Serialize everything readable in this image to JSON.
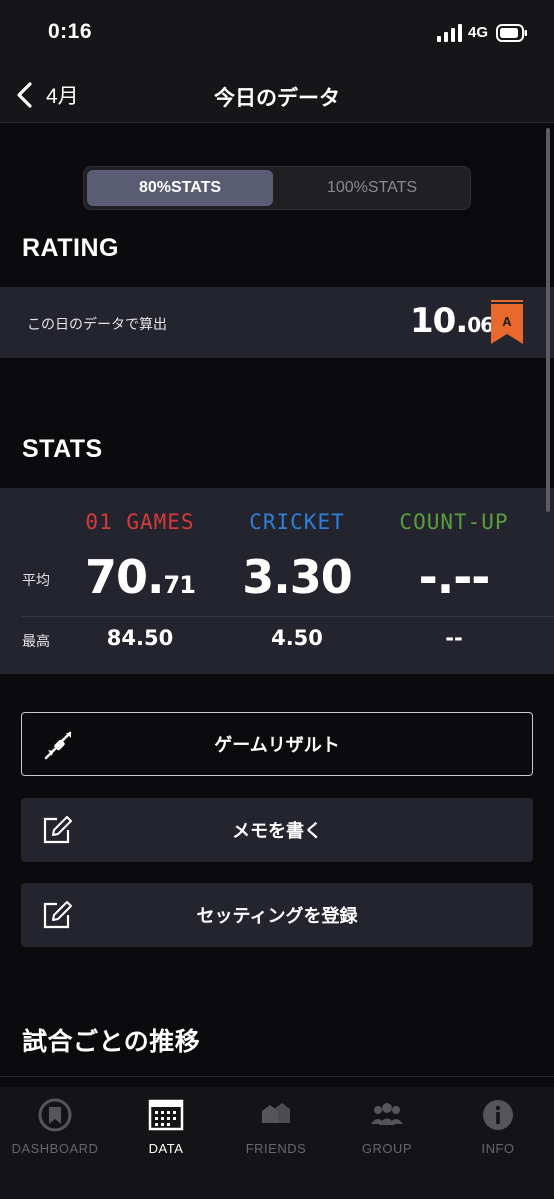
{
  "status_bar": {
    "time": "0:16",
    "network": "4G"
  },
  "nav": {
    "back_label": "4月",
    "title": "今日のデータ"
  },
  "segments": {
    "active": "80%STATS",
    "inactive": "100%STATS"
  },
  "rating": {
    "heading": "RATING",
    "description": "この日のデータで算出",
    "value_int": "10.",
    "value_dec": "06",
    "class_flag": "A",
    "flag_color": "#e8692b"
  },
  "stats": {
    "heading": "STATS",
    "categories": [
      {
        "label": "01 GAMES",
        "color": "#d33b3b"
      },
      {
        "label": "CRICKET",
        "color": "#2f7fd6"
      },
      {
        "label": "COUNT-UP",
        "color": "#5a9d3c"
      }
    ],
    "avg_label": "平均",
    "max_label": "最高",
    "avg": [
      {
        "int": "70.",
        "dec": "71"
      },
      {
        "int": "3.30",
        "dec": ""
      },
      {
        "int": "-.--",
        "dec": ""
      }
    ],
    "max": [
      "84.50",
      "4.50",
      "--"
    ]
  },
  "actions": [
    {
      "label": "ゲームリザルト",
      "icon": "dart-icon"
    },
    {
      "label": "メモを書く",
      "icon": "edit-icon"
    },
    {
      "label": "セッティングを登録",
      "icon": "edit-icon"
    }
  ],
  "trend_heading": "試合ごとの推移",
  "tabs": [
    {
      "label": "DASHBOARD",
      "icon": "dashboard-icon",
      "active": false
    },
    {
      "label": "DATA",
      "icon": "calendar-icon",
      "active": true
    },
    {
      "label": "FRIENDS",
      "icon": "friends-icon",
      "active": false
    },
    {
      "label": "GROUP",
      "icon": "group-icon",
      "active": false
    },
    {
      "label": "INFO",
      "icon": "info-icon",
      "active": false
    }
  ]
}
